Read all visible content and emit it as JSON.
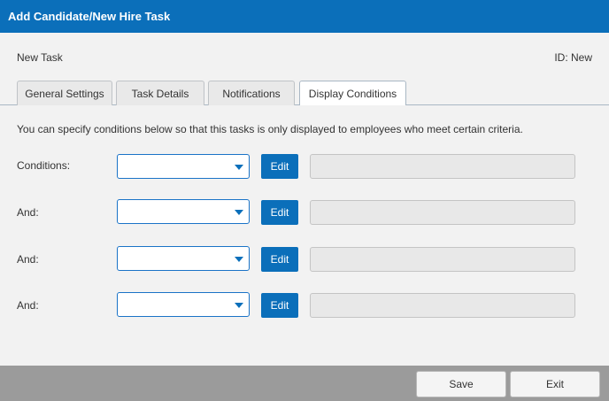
{
  "window": {
    "title": "Add Candidate/New Hire Task"
  },
  "header": {
    "task_name": "New Task",
    "task_id": "ID: New"
  },
  "tabs": [
    {
      "label": "General Settings"
    },
    {
      "label": "Task Details"
    },
    {
      "label": "Notifications"
    },
    {
      "label": "Display Conditions",
      "active": true
    }
  ],
  "main": {
    "intro": "You can specify conditions below so that this tasks is only displayed to employees who meet certain criteria.",
    "rows": [
      {
        "label": "Conditions:",
        "select_value": "",
        "edit_label": "Edit",
        "condition_text": ""
      },
      {
        "label": "And:",
        "select_value": "",
        "edit_label": "Edit",
        "condition_text": ""
      },
      {
        "label": "And:",
        "select_value": "",
        "edit_label": "Edit",
        "condition_text": ""
      },
      {
        "label": "And:",
        "select_value": "",
        "edit_label": "Edit",
        "condition_text": ""
      }
    ]
  },
  "footer": {
    "save_label": "Save",
    "exit_label": "Exit"
  },
  "colors": {
    "accent": "#0b6fba",
    "footer_bg": "#9b9b9b",
    "panel_bg": "#f2f2f2"
  },
  "icons": {
    "select_caret": "caret-down-icon"
  }
}
